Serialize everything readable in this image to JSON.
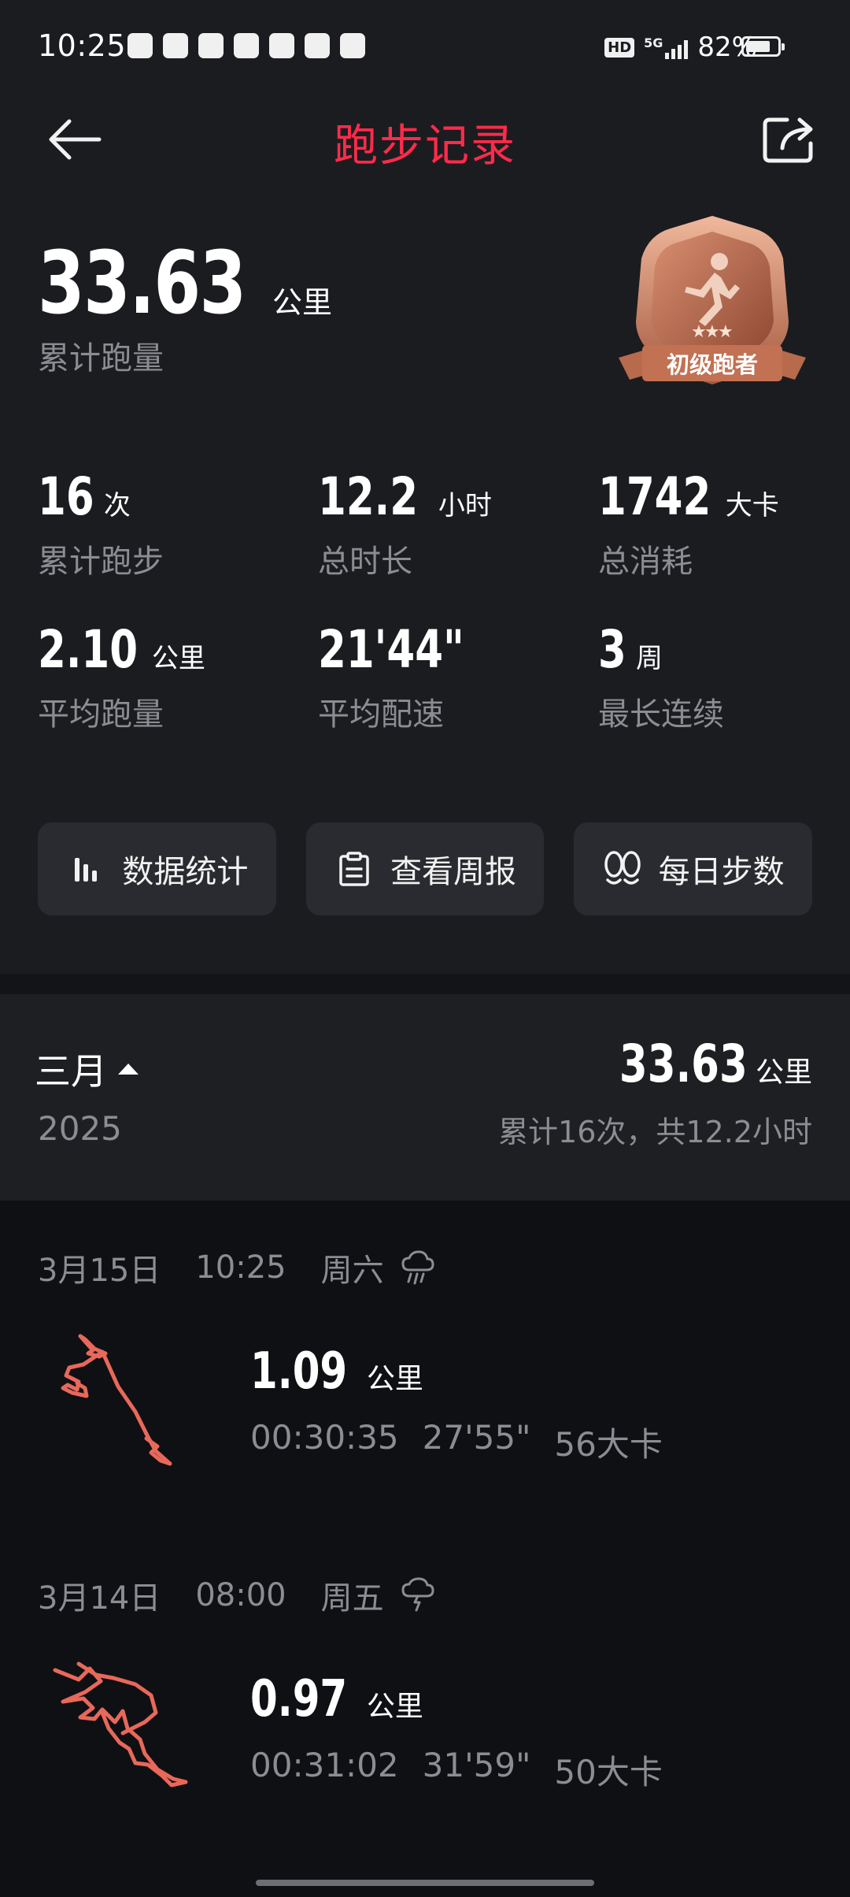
{
  "status_bar": {
    "time": "10:25",
    "hd_label": "HD",
    "network": "5G",
    "battery": "82%"
  },
  "header": {
    "title": "跑步记录",
    "title_color": "#ff2b4a"
  },
  "summary": {
    "total_distance": "33.63",
    "total_unit": "公里",
    "total_label": "累计跑量",
    "badge_text": "初级跑者",
    "badge_stars": 3,
    "stats": [
      {
        "value": "16",
        "unit": "次",
        "label": "累计跑步"
      },
      {
        "value": "12.2",
        "unit": "小时",
        "label": "总时长"
      },
      {
        "value": "1742",
        "unit": "大卡",
        "label": "总消耗"
      },
      {
        "value": "2.10",
        "unit": "公里",
        "label": "平均跑量"
      },
      {
        "value": "21'44\"",
        "unit": "",
        "label": "平均配速"
      },
      {
        "value": "3",
        "unit": "周",
        "label": "最长连续"
      }
    ]
  },
  "actions": [
    {
      "label": "数据统计",
      "icon": "bar-chart-icon"
    },
    {
      "label": "查看周报",
      "icon": "clipboard-icon"
    },
    {
      "label": "每日步数",
      "icon": "footprints-icon"
    }
  ],
  "month": {
    "name": "三月",
    "year": "2025",
    "distance": "33.63",
    "unit": "公里",
    "summary": "累计16次，共12.2小时"
  },
  "runs": [
    {
      "date": "3月15日",
      "time": "10:25",
      "weekday": "周六",
      "weather_icon": "rain-cloud-icon",
      "distance": "1.09",
      "unit": "公里",
      "duration": "00:30:35",
      "pace": "27'55\"",
      "calories": "56大卡"
    },
    {
      "date": "3月14日",
      "time": "08:00",
      "weekday": "周五",
      "weather_icon": "hail-cloud-icon",
      "distance": "0.97",
      "unit": "公里",
      "duration": "00:31:02",
      "pace": "31'59\"",
      "calories": "50大卡"
    }
  ],
  "route_color": "#e8685a"
}
